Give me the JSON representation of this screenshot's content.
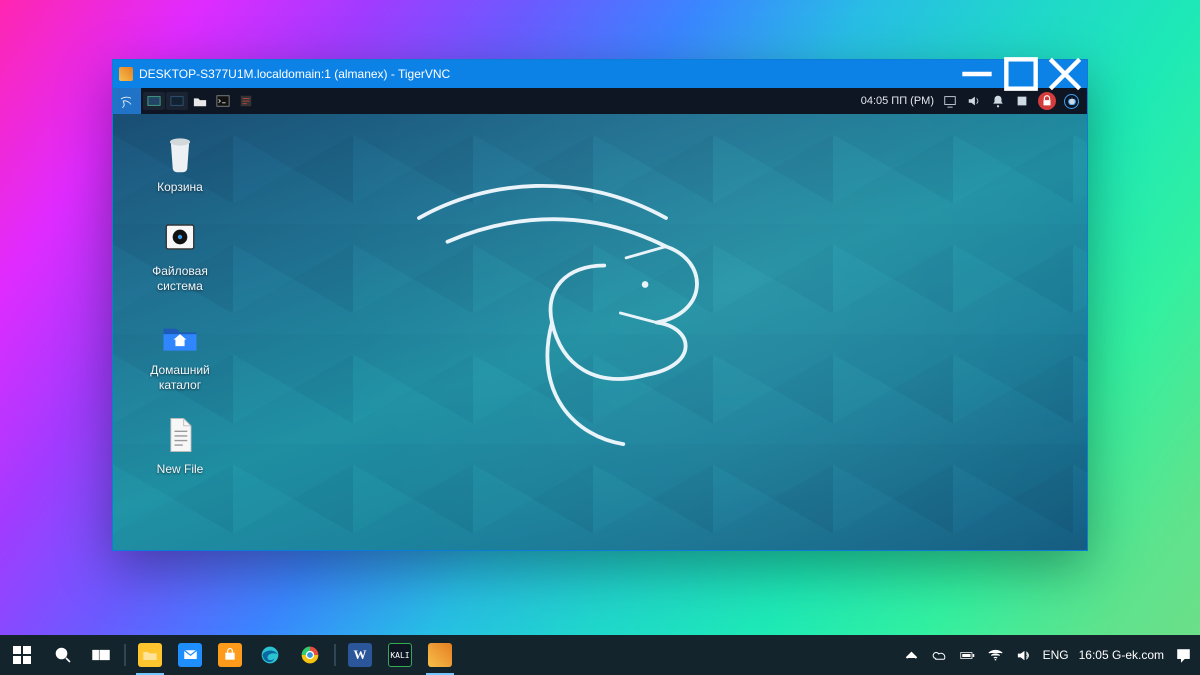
{
  "vnc": {
    "title": "DESKTOP-S377U1M.localdomain:1 (almanex) - TigerVNC",
    "kali_panel": {
      "clock": "04:05 ПП (PM)"
    },
    "desktop_icons": [
      {
        "id": "trash",
        "label": "Корзина"
      },
      {
        "id": "fs",
        "label": "Файловая система"
      },
      {
        "id": "home",
        "label": "Домашний каталог"
      },
      {
        "id": "newfile",
        "label": "New File"
      }
    ]
  },
  "windows_taskbar": {
    "lang": "ENG",
    "clock": "16:05",
    "brand": "G-ek.com"
  }
}
